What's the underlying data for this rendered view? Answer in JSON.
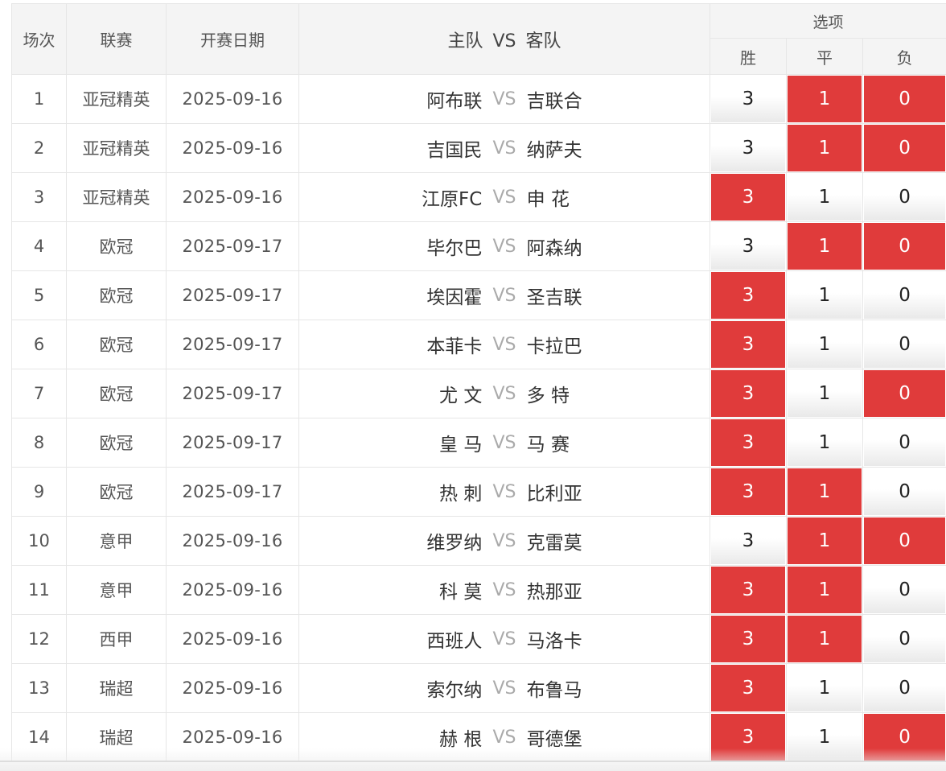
{
  "header": {
    "num": "场次",
    "league": "联赛",
    "date": "开赛日期",
    "home": "主队",
    "vs": "VS",
    "away": "客队",
    "options": "选项",
    "win": "胜",
    "draw": "平",
    "loss": "负"
  },
  "colors": {
    "selected": "#e03b3b",
    "header_bg": "#f4f4f4"
  },
  "rows": [
    {
      "num": "1",
      "league": "亚冠精英",
      "date": "2025-09-16",
      "home": "阿布联",
      "vs": "VS",
      "away": "吉联合",
      "opts": [
        {
          "label": "3",
          "selected": false
        },
        {
          "label": "1",
          "selected": true
        },
        {
          "label": "0",
          "selected": true
        }
      ]
    },
    {
      "num": "2",
      "league": "亚冠精英",
      "date": "2025-09-16",
      "home": "吉国民",
      "vs": "VS",
      "away": "纳萨夫",
      "opts": [
        {
          "label": "3",
          "selected": false
        },
        {
          "label": "1",
          "selected": true
        },
        {
          "label": "0",
          "selected": true
        }
      ]
    },
    {
      "num": "3",
      "league": "亚冠精英",
      "date": "2025-09-16",
      "home": "江原FC",
      "vs": "VS",
      "away": "申 花",
      "opts": [
        {
          "label": "3",
          "selected": true
        },
        {
          "label": "1",
          "selected": false
        },
        {
          "label": "0",
          "selected": false
        }
      ]
    },
    {
      "num": "4",
      "league": "欧冠",
      "date": "2025-09-17",
      "home": "毕尔巴",
      "vs": "VS",
      "away": "阿森纳",
      "opts": [
        {
          "label": "3",
          "selected": false
        },
        {
          "label": "1",
          "selected": true
        },
        {
          "label": "0",
          "selected": true
        }
      ]
    },
    {
      "num": "5",
      "league": "欧冠",
      "date": "2025-09-17",
      "home": "埃因霍",
      "vs": "VS",
      "away": "圣吉联",
      "opts": [
        {
          "label": "3",
          "selected": true
        },
        {
          "label": "1",
          "selected": false
        },
        {
          "label": "0",
          "selected": false
        }
      ]
    },
    {
      "num": "6",
      "league": "欧冠",
      "date": "2025-09-17",
      "home": "本菲卡",
      "vs": "VS",
      "away": "卡拉巴",
      "opts": [
        {
          "label": "3",
          "selected": true
        },
        {
          "label": "1",
          "selected": false
        },
        {
          "label": "0",
          "selected": false
        }
      ]
    },
    {
      "num": "7",
      "league": "欧冠",
      "date": "2025-09-17",
      "home": "尤 文",
      "vs": "VS",
      "away": "多 特",
      "opts": [
        {
          "label": "3",
          "selected": true
        },
        {
          "label": "1",
          "selected": false
        },
        {
          "label": "0",
          "selected": true
        }
      ]
    },
    {
      "num": "8",
      "league": "欧冠",
      "date": "2025-09-17",
      "home": "皇 马",
      "vs": "VS",
      "away": "马 赛",
      "opts": [
        {
          "label": "3",
          "selected": true
        },
        {
          "label": "1",
          "selected": false
        },
        {
          "label": "0",
          "selected": false
        }
      ]
    },
    {
      "num": "9",
      "league": "欧冠",
      "date": "2025-09-17",
      "home": "热 刺",
      "vs": "VS",
      "away": "比利亚",
      "opts": [
        {
          "label": "3",
          "selected": true
        },
        {
          "label": "1",
          "selected": true
        },
        {
          "label": "0",
          "selected": false
        }
      ]
    },
    {
      "num": "10",
      "league": "意甲",
      "date": "2025-09-16",
      "home": "维罗纳",
      "vs": "VS",
      "away": "克雷莫",
      "opts": [
        {
          "label": "3",
          "selected": false
        },
        {
          "label": "1",
          "selected": true
        },
        {
          "label": "0",
          "selected": true
        }
      ]
    },
    {
      "num": "11",
      "league": "意甲",
      "date": "2025-09-16",
      "home": "科 莫",
      "vs": "VS",
      "away": "热那亚",
      "opts": [
        {
          "label": "3",
          "selected": true
        },
        {
          "label": "1",
          "selected": true
        },
        {
          "label": "0",
          "selected": false
        }
      ]
    },
    {
      "num": "12",
      "league": "西甲",
      "date": "2025-09-16",
      "home": "西班人",
      "vs": "VS",
      "away": "马洛卡",
      "opts": [
        {
          "label": "3",
          "selected": true
        },
        {
          "label": "1",
          "selected": true
        },
        {
          "label": "0",
          "selected": false
        }
      ]
    },
    {
      "num": "13",
      "league": "瑞超",
      "date": "2025-09-16",
      "home": "索尔纳",
      "vs": "VS",
      "away": "布鲁马",
      "opts": [
        {
          "label": "3",
          "selected": true
        },
        {
          "label": "1",
          "selected": false
        },
        {
          "label": "0",
          "selected": false
        }
      ]
    },
    {
      "num": "14",
      "league": "瑞超",
      "date": "2025-09-16",
      "home": "赫 根",
      "vs": "VS",
      "away": "哥德堡",
      "opts": [
        {
          "label": "3",
          "selected": true
        },
        {
          "label": "1",
          "selected": false
        },
        {
          "label": "0",
          "selected": true
        }
      ]
    }
  ]
}
